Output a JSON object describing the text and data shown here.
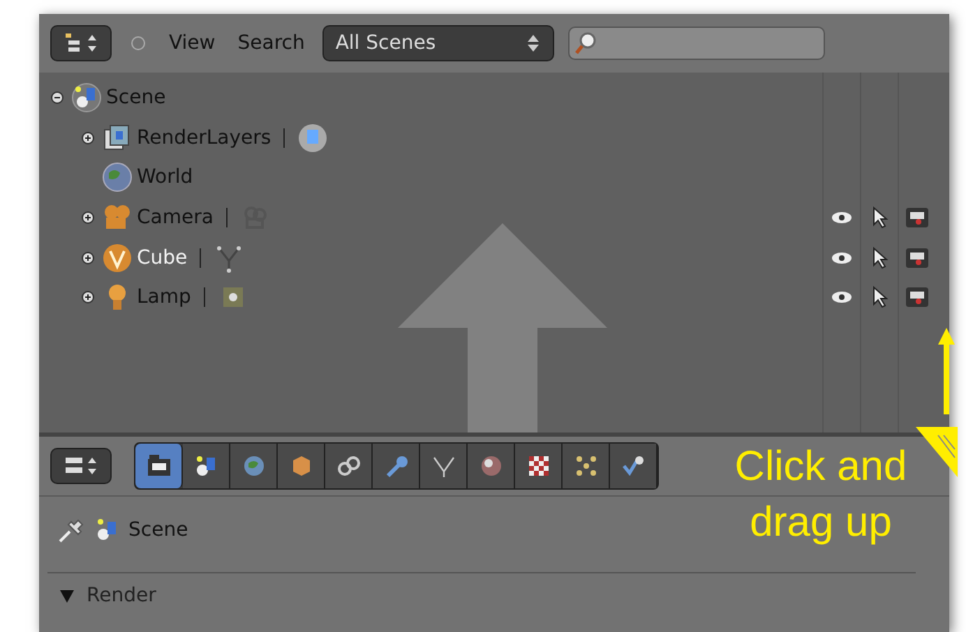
{
  "outliner": {
    "header": {
      "menus": [
        "View",
        "Search"
      ],
      "display_mode": "All Scenes"
    },
    "tree": [
      {
        "label": "Scene",
        "kind": "scene",
        "expanded": true,
        "selected": false,
        "children": [
          {
            "label": "RenderLayers",
            "kind": "render_layers",
            "expanded": false,
            "selected": false
          },
          {
            "label": "World",
            "kind": "world",
            "selected": false
          },
          {
            "label": "Camera",
            "kind": "camera",
            "expanded": false,
            "selected": false
          },
          {
            "label": "Cube",
            "kind": "mesh",
            "expanded": false,
            "selected": true
          },
          {
            "label": "Lamp",
            "kind": "lamp",
            "expanded": false,
            "selected": false
          }
        ]
      }
    ]
  },
  "properties": {
    "tabs": [
      {
        "kind": "render",
        "selected": true
      },
      {
        "kind": "scene",
        "selected": false
      },
      {
        "kind": "world",
        "selected": false
      },
      {
        "kind": "object",
        "selected": false
      },
      {
        "kind": "constraints",
        "selected": false
      },
      {
        "kind": "modifiers",
        "selected": false
      },
      {
        "kind": "data",
        "selected": false
      },
      {
        "kind": "material",
        "selected": false
      },
      {
        "kind": "texture",
        "selected": false
      },
      {
        "kind": "particles",
        "selected": false
      },
      {
        "kind": "physics",
        "selected": false
      }
    ],
    "breadcrumb": "Scene",
    "panels": [
      {
        "label": "Render",
        "expanded": true
      }
    ]
  },
  "annotation": {
    "text": "Click and drag up"
  }
}
